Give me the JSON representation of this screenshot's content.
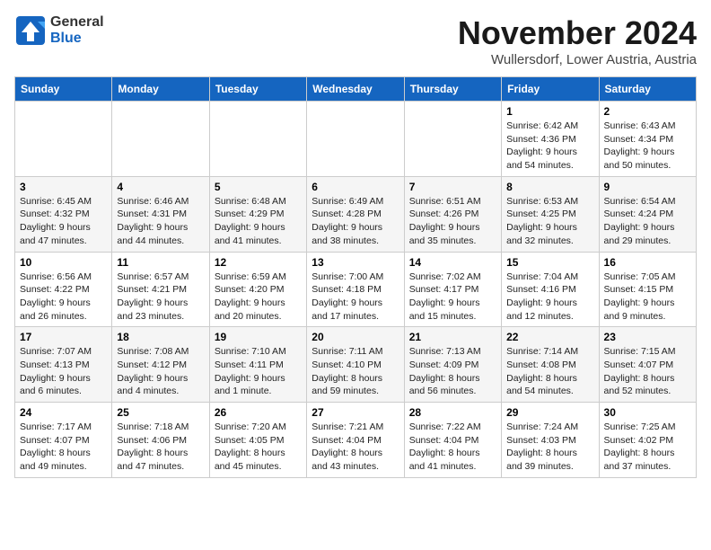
{
  "logo": {
    "general": "General",
    "blue": "Blue"
  },
  "header": {
    "month": "November 2024",
    "location": "Wullersdorf, Lower Austria, Austria"
  },
  "weekdays": [
    "Sunday",
    "Monday",
    "Tuesday",
    "Wednesday",
    "Thursday",
    "Friday",
    "Saturday"
  ],
  "weeks": [
    [
      {
        "day": "",
        "info": ""
      },
      {
        "day": "",
        "info": ""
      },
      {
        "day": "",
        "info": ""
      },
      {
        "day": "",
        "info": ""
      },
      {
        "day": "",
        "info": ""
      },
      {
        "day": "1",
        "info": "Sunrise: 6:42 AM\nSunset: 4:36 PM\nDaylight: 9 hours\nand 54 minutes."
      },
      {
        "day": "2",
        "info": "Sunrise: 6:43 AM\nSunset: 4:34 PM\nDaylight: 9 hours\nand 50 minutes."
      }
    ],
    [
      {
        "day": "3",
        "info": "Sunrise: 6:45 AM\nSunset: 4:32 PM\nDaylight: 9 hours\nand 47 minutes."
      },
      {
        "day": "4",
        "info": "Sunrise: 6:46 AM\nSunset: 4:31 PM\nDaylight: 9 hours\nand 44 minutes."
      },
      {
        "day": "5",
        "info": "Sunrise: 6:48 AM\nSunset: 4:29 PM\nDaylight: 9 hours\nand 41 minutes."
      },
      {
        "day": "6",
        "info": "Sunrise: 6:49 AM\nSunset: 4:28 PM\nDaylight: 9 hours\nand 38 minutes."
      },
      {
        "day": "7",
        "info": "Sunrise: 6:51 AM\nSunset: 4:26 PM\nDaylight: 9 hours\nand 35 minutes."
      },
      {
        "day": "8",
        "info": "Sunrise: 6:53 AM\nSunset: 4:25 PM\nDaylight: 9 hours\nand 32 minutes."
      },
      {
        "day": "9",
        "info": "Sunrise: 6:54 AM\nSunset: 4:24 PM\nDaylight: 9 hours\nand 29 minutes."
      }
    ],
    [
      {
        "day": "10",
        "info": "Sunrise: 6:56 AM\nSunset: 4:22 PM\nDaylight: 9 hours\nand 26 minutes."
      },
      {
        "day": "11",
        "info": "Sunrise: 6:57 AM\nSunset: 4:21 PM\nDaylight: 9 hours\nand 23 minutes."
      },
      {
        "day": "12",
        "info": "Sunrise: 6:59 AM\nSunset: 4:20 PM\nDaylight: 9 hours\nand 20 minutes."
      },
      {
        "day": "13",
        "info": "Sunrise: 7:00 AM\nSunset: 4:18 PM\nDaylight: 9 hours\nand 17 minutes."
      },
      {
        "day": "14",
        "info": "Sunrise: 7:02 AM\nSunset: 4:17 PM\nDaylight: 9 hours\nand 15 minutes."
      },
      {
        "day": "15",
        "info": "Sunrise: 7:04 AM\nSunset: 4:16 PM\nDaylight: 9 hours\nand 12 minutes."
      },
      {
        "day": "16",
        "info": "Sunrise: 7:05 AM\nSunset: 4:15 PM\nDaylight: 9 hours\nand 9 minutes."
      }
    ],
    [
      {
        "day": "17",
        "info": "Sunrise: 7:07 AM\nSunset: 4:13 PM\nDaylight: 9 hours\nand 6 minutes."
      },
      {
        "day": "18",
        "info": "Sunrise: 7:08 AM\nSunset: 4:12 PM\nDaylight: 9 hours\nand 4 minutes."
      },
      {
        "day": "19",
        "info": "Sunrise: 7:10 AM\nSunset: 4:11 PM\nDaylight: 9 hours\nand 1 minute."
      },
      {
        "day": "20",
        "info": "Sunrise: 7:11 AM\nSunset: 4:10 PM\nDaylight: 8 hours\nand 59 minutes."
      },
      {
        "day": "21",
        "info": "Sunrise: 7:13 AM\nSunset: 4:09 PM\nDaylight: 8 hours\nand 56 minutes."
      },
      {
        "day": "22",
        "info": "Sunrise: 7:14 AM\nSunset: 4:08 PM\nDaylight: 8 hours\nand 54 minutes."
      },
      {
        "day": "23",
        "info": "Sunrise: 7:15 AM\nSunset: 4:07 PM\nDaylight: 8 hours\nand 52 minutes."
      }
    ],
    [
      {
        "day": "24",
        "info": "Sunrise: 7:17 AM\nSunset: 4:07 PM\nDaylight: 8 hours\nand 49 minutes."
      },
      {
        "day": "25",
        "info": "Sunrise: 7:18 AM\nSunset: 4:06 PM\nDaylight: 8 hours\nand 47 minutes."
      },
      {
        "day": "26",
        "info": "Sunrise: 7:20 AM\nSunset: 4:05 PM\nDaylight: 8 hours\nand 45 minutes."
      },
      {
        "day": "27",
        "info": "Sunrise: 7:21 AM\nSunset: 4:04 PM\nDaylight: 8 hours\nand 43 minutes."
      },
      {
        "day": "28",
        "info": "Sunrise: 7:22 AM\nSunset: 4:04 PM\nDaylight: 8 hours\nand 41 minutes."
      },
      {
        "day": "29",
        "info": "Sunrise: 7:24 AM\nSunset: 4:03 PM\nDaylight: 8 hours\nand 39 minutes."
      },
      {
        "day": "30",
        "info": "Sunrise: 7:25 AM\nSunset: 4:02 PM\nDaylight: 8 hours\nand 37 minutes."
      }
    ]
  ]
}
